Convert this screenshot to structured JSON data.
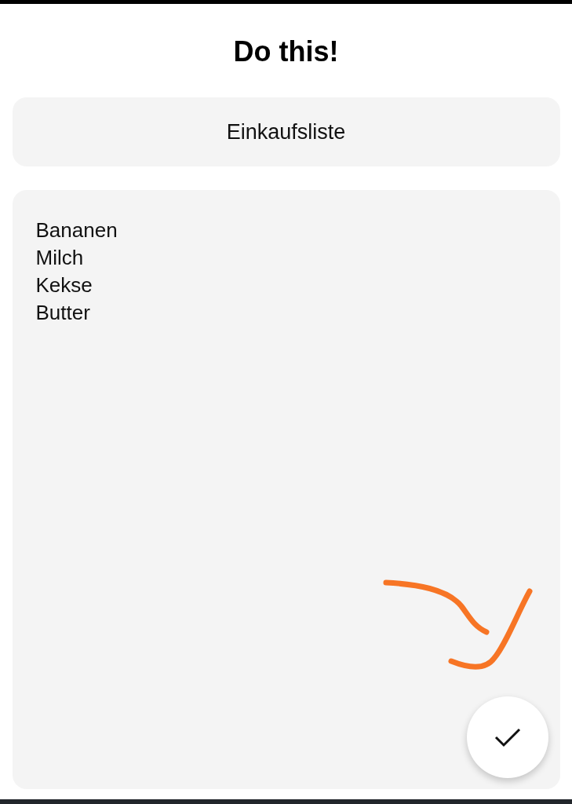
{
  "title": "Do this!",
  "title_field": {
    "value": "Einkaufsliste"
  },
  "note_field": {
    "value": "Bananen\nMilch\nKekse\nButter"
  },
  "fab": {
    "kind": "confirm"
  }
}
